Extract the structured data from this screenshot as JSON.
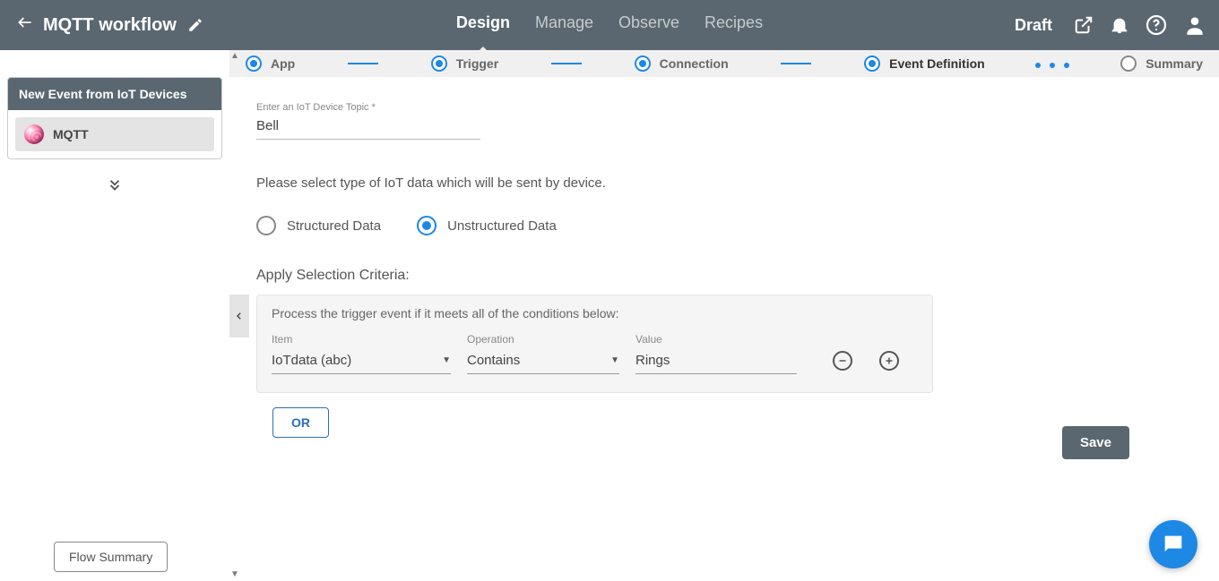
{
  "header": {
    "title": "MQTT workflow",
    "status": "Draft",
    "tabs": [
      {
        "label": "Design",
        "active": true
      },
      {
        "label": "Manage",
        "active": false
      },
      {
        "label": "Observe",
        "active": false
      },
      {
        "label": "Recipes",
        "active": false
      }
    ]
  },
  "sidebar": {
    "card_title": "New Event from IoT Devices",
    "app_name": "MQTT",
    "flow_summary_btn": "Flow Summary"
  },
  "stepper": {
    "steps": [
      {
        "label": "App",
        "state": "done"
      },
      {
        "label": "Trigger",
        "state": "done"
      },
      {
        "label": "Connection",
        "state": "done"
      },
      {
        "label": "Event Definition",
        "state": "current"
      },
      {
        "label": "Summary",
        "state": "pending"
      }
    ]
  },
  "form": {
    "topic_label": "Enter an IoT Device Topic *",
    "topic_value": "Bell",
    "type_helper": "Please select type of IoT data which will be sent by device.",
    "radio": {
      "structured": "Structured Data",
      "unstructured": "Unstructured Data",
      "selected": "unstructured"
    },
    "criteria_title": "Apply Selection Criteria:",
    "criteria_cond_text": "Process the trigger event if it meets all of the conditions below:",
    "columns": {
      "item": "Item",
      "op": "Operation",
      "val": "Value"
    },
    "row": {
      "item_display": "IoTdata  (abc)",
      "op_display": "Contains",
      "val_value": "Rings"
    },
    "or_btn": "OR",
    "save_btn": "Save"
  }
}
